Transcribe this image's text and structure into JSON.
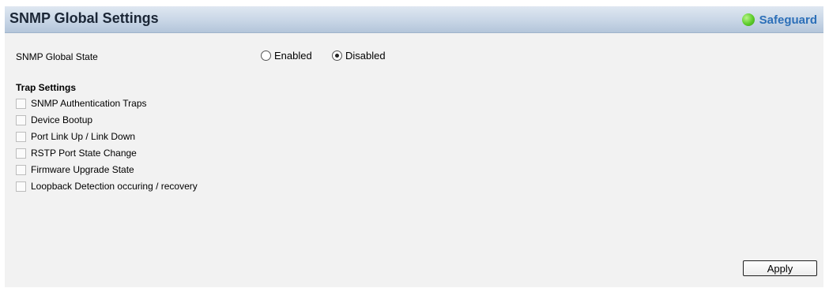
{
  "header": {
    "title": "SNMP Global Settings",
    "safeguard_label": "Safeguard"
  },
  "colors": {
    "header_gradient_top": "#dfe7f1",
    "header_gradient_bottom": "#b4c5da",
    "safeguard_text": "#2c6fb8",
    "safeguard_indicator": "#5ccc2a",
    "panel_background": "#f2f2f2"
  },
  "global_state": {
    "label": "SNMP Global State",
    "options": [
      {
        "label": "Enabled",
        "selected": false
      },
      {
        "label": "Disabled",
        "selected": true
      }
    ]
  },
  "trap_settings": {
    "heading": "Trap Settings",
    "items": [
      {
        "label": "SNMP Authentication Traps",
        "checked": false
      },
      {
        "label": "Device Bootup",
        "checked": false
      },
      {
        "label": "Port Link Up / Link Down",
        "checked": false
      },
      {
        "label": "RSTP Port State Change",
        "checked": false
      },
      {
        "label": "Firmware Upgrade State",
        "checked": false
      },
      {
        "label": "Loopback Detection occuring / recovery",
        "checked": false
      }
    ]
  },
  "actions": {
    "apply_label": "Apply"
  }
}
